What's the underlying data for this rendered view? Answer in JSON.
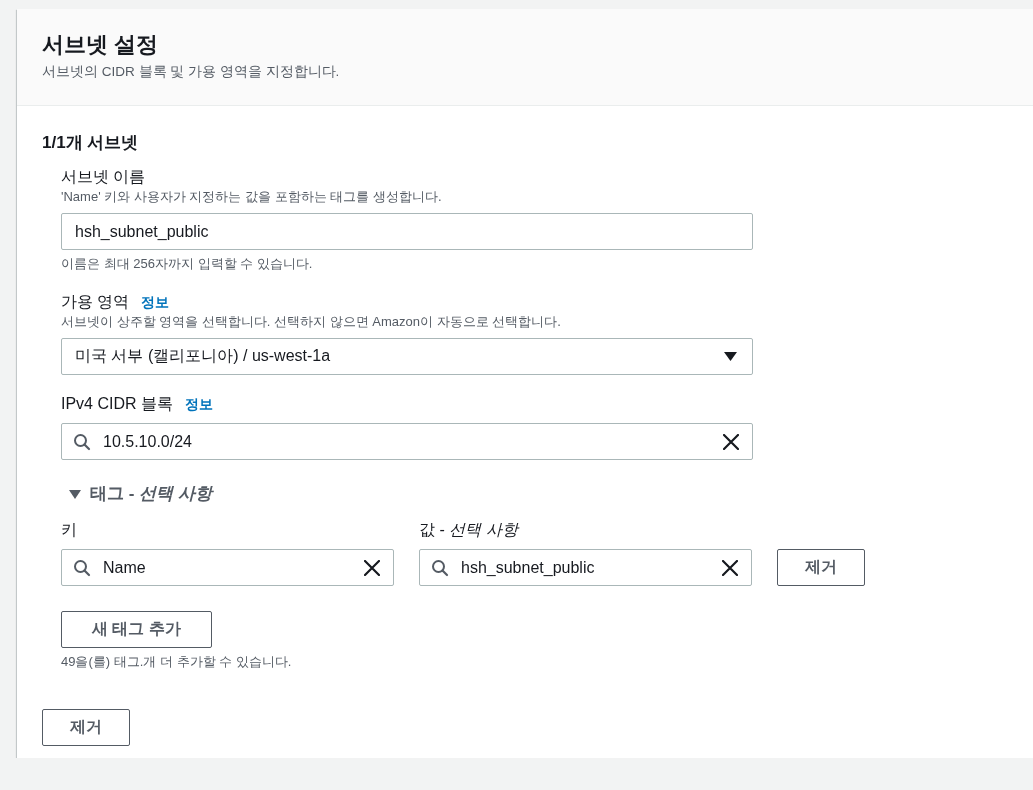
{
  "panel": {
    "title": "서브넷 설정",
    "description": "서브넷의 CIDR 블록 및 가용 영역을 지정합니다."
  },
  "subnet": {
    "heading": "1/1개 서브넷",
    "fields": [
      {
        "kind": "text",
        "label": "서브넷 이름",
        "description": "'Name' 키와 사용자가 지정하는 값을 포함하는 태그를 생성합니다.",
        "value": "hsh_subnet_public",
        "constraint": "이름은 최대 256자까지 입력할 수 있습니다."
      },
      {
        "kind": "select",
        "label": "가용 영역",
        "info": "정보",
        "description": "서브넷이 상주할 영역을 선택합니다. 선택하지 않으면 Amazon이 자동으로 선택합니다.",
        "value": "미국 서부 (캘리포니아) / us-west-1a"
      },
      {
        "kind": "search",
        "label": "IPv4 CIDR 블록",
        "info": "정보",
        "value": "10.5.10.0/24"
      }
    ],
    "tags": {
      "expanded": true,
      "heading": "태그 - *선택 사항*",
      "key_label": "키",
      "value_label": "값 - *선택 사항*",
      "rows": [
        {
          "key": "Name",
          "value": "hsh_subnet_public",
          "remove_button": "제거"
        }
      ],
      "add_button": "새 태그 추가",
      "limit_note": "49을(를) 태그.개 더 추가할 수 있습니다."
    },
    "remove_button": "제거"
  }
}
